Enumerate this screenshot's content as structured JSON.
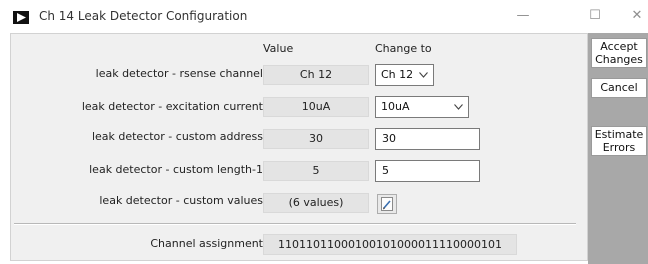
{
  "window": {
    "title": "Ch 14 Leak Detector Configuration",
    "minimize_glyph": "—",
    "maximize_glyph": "☐",
    "close_glyph": "✕"
  },
  "columns": {
    "value": "Value",
    "change_to": "Change to"
  },
  "rows": [
    {
      "label": "leak detector - rsense channel",
      "value": "Ch 12",
      "change_to": "Ch 12",
      "control": "dropdown"
    },
    {
      "label": "leak detector - excitation current",
      "value": "10uA",
      "change_to": "10uA",
      "control": "dropdown"
    },
    {
      "label": "leak detector - custom address",
      "value": "30",
      "change_to": "30",
      "control": "text"
    },
    {
      "label": "leak detector - custom length-1",
      "value": "5",
      "change_to": "5",
      "control": "text"
    },
    {
      "label": "leak detector - custom values",
      "value": "(6 values)",
      "control": "edit-button"
    }
  ],
  "channel_assignment": {
    "label": "Channel assignment",
    "value": "11011011000100101000011110000101"
  },
  "side_buttons": {
    "accept_line1": "Accept",
    "accept_line2": "Changes",
    "cancel": "Cancel",
    "estimate_line1": "Estimate",
    "estimate_line2": "Errors"
  },
  "icons": {
    "app": "play-triangle-icon",
    "dropdown": "chevron-down-icon",
    "edit": "pencil-icon"
  },
  "colors": {
    "panel_bg": "#f0f0f0",
    "side_pane_bg": "#a8a8a8",
    "value_box_bg": "#e4e4e4"
  }
}
